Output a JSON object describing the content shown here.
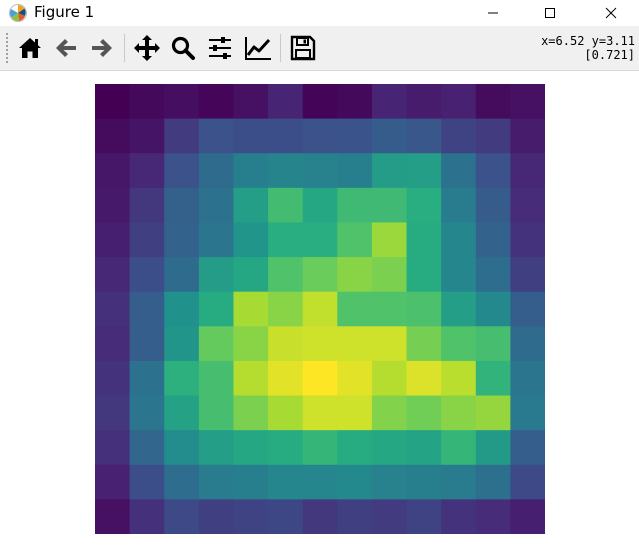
{
  "window": {
    "title": "Figure 1",
    "app_icon": "matplotlib-logo-icon",
    "controls": [
      "minimize-icon",
      "maximize-icon",
      "close-icon"
    ]
  },
  "toolbar": {
    "buttons": [
      {
        "name": "home-button",
        "icon": "home-icon"
      },
      {
        "name": "back-button",
        "icon": "arrow-left-icon"
      },
      {
        "name": "forward-button",
        "icon": "arrow-right-icon"
      },
      {
        "name": "pan-button",
        "icon": "move-arrows-icon"
      },
      {
        "name": "zoom-button",
        "icon": "magnifier-icon"
      },
      {
        "name": "configure-subplots-button",
        "icon": "sliders-icon"
      },
      {
        "name": "edit-axes-button",
        "icon": "line-chart-icon"
      },
      {
        "name": "save-button",
        "icon": "floppy-disk-icon"
      }
    ],
    "coords_line1": "x=6.52 y=3.11",
    "coords_line2": "[0.721]"
  },
  "chart_data": {
    "type": "heatmap",
    "colormap": "viridis",
    "rows": 13,
    "cols": 13,
    "vmin": 0.0,
    "vmax": 1.0,
    "values": [
      [
        0.0,
        0.03,
        0.05,
        0.02,
        0.06,
        0.13,
        0.01,
        0.03,
        0.13,
        0.1,
        0.12,
        0.04,
        0.06
      ],
      [
        0.04,
        0.07,
        0.19,
        0.25,
        0.24,
        0.24,
        0.25,
        0.26,
        0.29,
        0.27,
        0.21,
        0.19,
        0.1
      ],
      [
        0.08,
        0.14,
        0.25,
        0.35,
        0.43,
        0.45,
        0.44,
        0.43,
        0.55,
        0.56,
        0.38,
        0.25,
        0.14
      ],
      [
        0.09,
        0.18,
        0.31,
        0.38,
        0.56,
        0.69,
        0.6,
        0.68,
        0.68,
        0.63,
        0.42,
        0.29,
        0.15
      ],
      [
        0.11,
        0.2,
        0.32,
        0.39,
        0.52,
        0.63,
        0.63,
        0.72,
        0.85,
        0.62,
        0.46,
        0.32,
        0.17
      ],
      [
        0.14,
        0.24,
        0.35,
        0.55,
        0.6,
        0.72,
        0.77,
        0.82,
        0.8,
        0.62,
        0.46,
        0.36,
        0.2
      ],
      [
        0.16,
        0.3,
        0.5,
        0.62,
        0.87,
        0.82,
        0.91,
        0.72,
        0.72,
        0.71,
        0.56,
        0.47,
        0.3
      ],
      [
        0.15,
        0.3,
        0.52,
        0.76,
        0.82,
        0.92,
        0.93,
        0.93,
        0.93,
        0.79,
        0.72,
        0.7,
        0.35
      ],
      [
        0.17,
        0.38,
        0.64,
        0.7,
        0.89,
        0.96,
        1.0,
        0.96,
        0.89,
        0.95,
        0.9,
        0.65,
        0.39
      ],
      [
        0.18,
        0.39,
        0.57,
        0.7,
        0.8,
        0.87,
        0.93,
        0.93,
        0.81,
        0.78,
        0.82,
        0.84,
        0.41
      ],
      [
        0.16,
        0.33,
        0.48,
        0.56,
        0.6,
        0.62,
        0.66,
        0.62,
        0.6,
        0.58,
        0.66,
        0.54,
        0.3
      ],
      [
        0.12,
        0.24,
        0.36,
        0.42,
        0.43,
        0.46,
        0.46,
        0.47,
        0.44,
        0.43,
        0.42,
        0.37,
        0.23
      ],
      [
        0.06,
        0.16,
        0.23,
        0.2,
        0.21,
        0.22,
        0.18,
        0.2,
        0.19,
        0.21,
        0.17,
        0.15,
        0.11
      ]
    ]
  }
}
